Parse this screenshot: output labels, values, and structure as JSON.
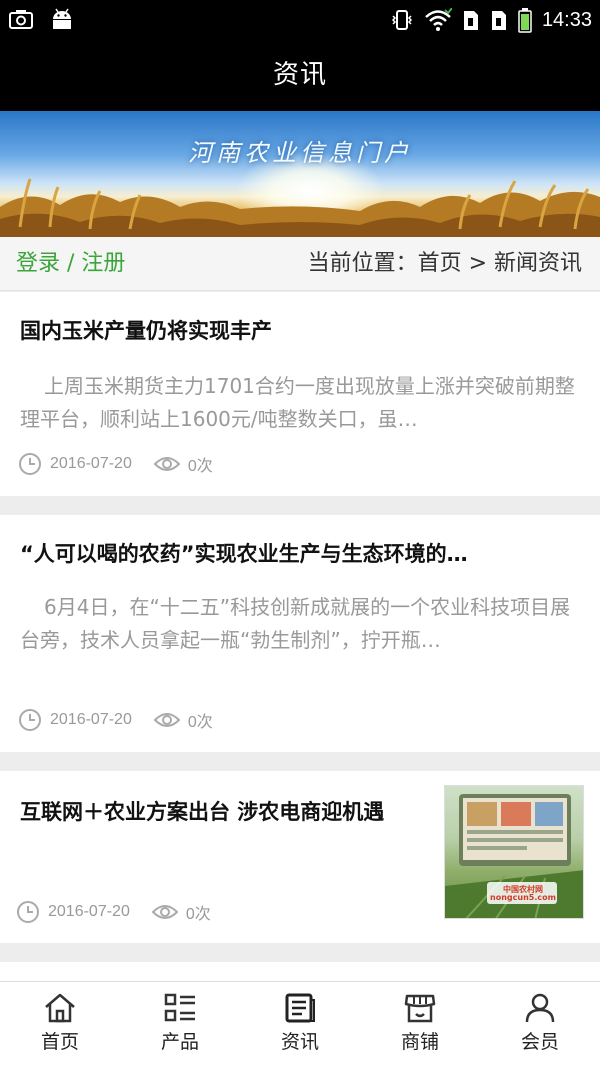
{
  "status_bar": {
    "time": "14:33",
    "icons": [
      "screenshot-icon",
      "android-icon",
      "vibrate-icon",
      "wifi-icon",
      "sim1-icon",
      "sim2-icon",
      "battery-icon"
    ]
  },
  "header": {
    "title": "资讯"
  },
  "banner": {
    "title": "河南农业信息门户"
  },
  "location_bar": {
    "login_label": "登录 / 注册",
    "breadcrumb": "当前位置：首页 > 新闻资讯"
  },
  "articles": [
    {
      "title": "国内玉米产量仍将实现丰产",
      "summary": "上周玉米期货主力1701合约一度出现放量上涨并突破前期整理平台，顺利站上1600元/吨整数关口，虽…",
      "date": "2016-07-20",
      "views": "0次"
    },
    {
      "title": "“人可以喝的农药”实现农业生产与生态环境的…",
      "summary": "6月4日，在“十二五”科技创新成就展的一个农业科技项目展台旁，技术人员拿起一瓶“勃生制剂”，拧开瓶…",
      "date": "2016-07-20",
      "views": "0次"
    },
    {
      "title": "互联网＋农业方案出台 涉农电商迎机遇",
      "date": "2016-07-20",
      "views": "0次",
      "thumb_caption": "中国农村网 nongcun5.com"
    }
  ],
  "bottom_nav": [
    {
      "label": "首页",
      "icon": "home-icon"
    },
    {
      "label": "产品",
      "icon": "grid-list-icon"
    },
    {
      "label": "资讯",
      "icon": "news-icon"
    },
    {
      "label": "商铺",
      "icon": "shop-icon"
    },
    {
      "label": "会员",
      "icon": "user-icon"
    }
  ],
  "colors": {
    "accent_green": "#3aa53a",
    "header_bg": "#000000",
    "meta_gray": "#999999"
  }
}
